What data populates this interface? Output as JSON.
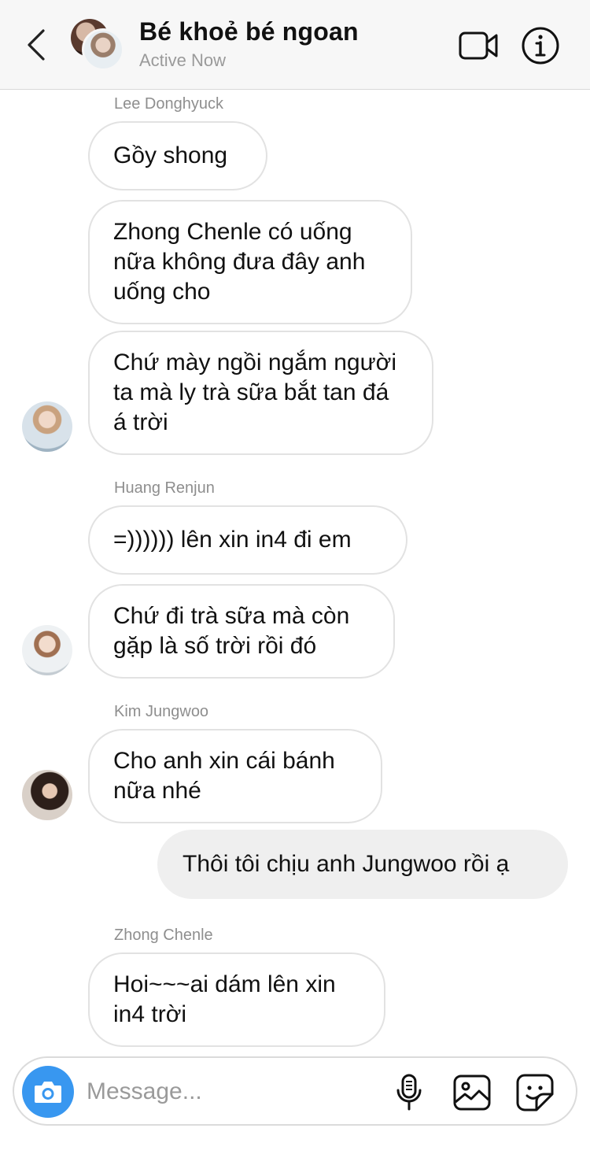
{
  "header": {
    "title": "Bé khoẻ bé ngoan",
    "status": "Active Now"
  },
  "messages": [
    {
      "sender": "Lee Donghyuck",
      "bubbles": [
        "Gồy shong",
        "Zhong Chenle có uống nữa không đưa đây anh uống cho",
        "Chứ mày ngồi ngắm người ta mà ly trà sữa bắt tan đá á trời"
      ]
    },
    {
      "sender": "Huang Renjun",
      "bubbles": [
        "=)))))) lên xin in4 đi em",
        "Chứ đi trà sữa mà còn gặp là số trời rồi đó"
      ]
    },
    {
      "sender": "Kim Jungwoo",
      "bubbles": [
        "Cho anh xin cái bánh nữa nhé"
      ]
    },
    {
      "sender": "me",
      "bubbles": [
        "Thôi tôi chịu anh Jungwoo rồi ạ"
      ]
    },
    {
      "sender": "Zhong Chenle",
      "bubbles": [
        "Hoi~~~ai dám lên xin in4 trời"
      ]
    }
  ],
  "composer": {
    "placeholder": "Message..."
  },
  "icons": {
    "back": "chevron-left-icon",
    "video": "video-camera-icon",
    "info": "info-icon",
    "camera": "camera-icon",
    "mic": "microphone-icon",
    "gallery": "image-icon",
    "sticker": "sticker-icon"
  },
  "colors": {
    "accent": "#3897f0",
    "header_bg": "#f7f7f7",
    "bubble_border": "#e2e2e2",
    "my_bubble": "#efefef"
  }
}
